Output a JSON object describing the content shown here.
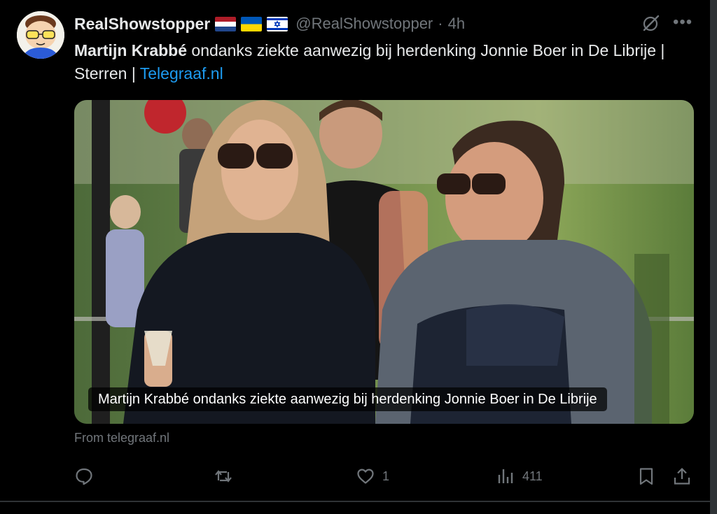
{
  "author": {
    "name": "RealShowstopper",
    "handle": "@RealShowstopper",
    "separator": "·",
    "time": "4h",
    "flags": [
      "netherlands-flag",
      "ukraine-flag",
      "israel-flag"
    ]
  },
  "tweet": {
    "bold_name": "Martijn Krabbé",
    "text_rest": " ondanks ziekte aanwezig bij herdenking Jonnie Boer in De Librije | Sterren | ",
    "link_text": "Telegraaf.nl"
  },
  "card": {
    "caption": "Martijn Krabbé ondanks ziekte aanwezig bij herdenking Jonnie Boer in De Librije",
    "source": "From telegraaf.nl"
  },
  "actions": {
    "reply_count": "",
    "retweet_count": "",
    "like_count": "1",
    "views_count": "411"
  },
  "colors": {
    "background": "#000000",
    "text": "#e7e9ea",
    "muted": "#71767b",
    "link": "#1d9bf0"
  }
}
